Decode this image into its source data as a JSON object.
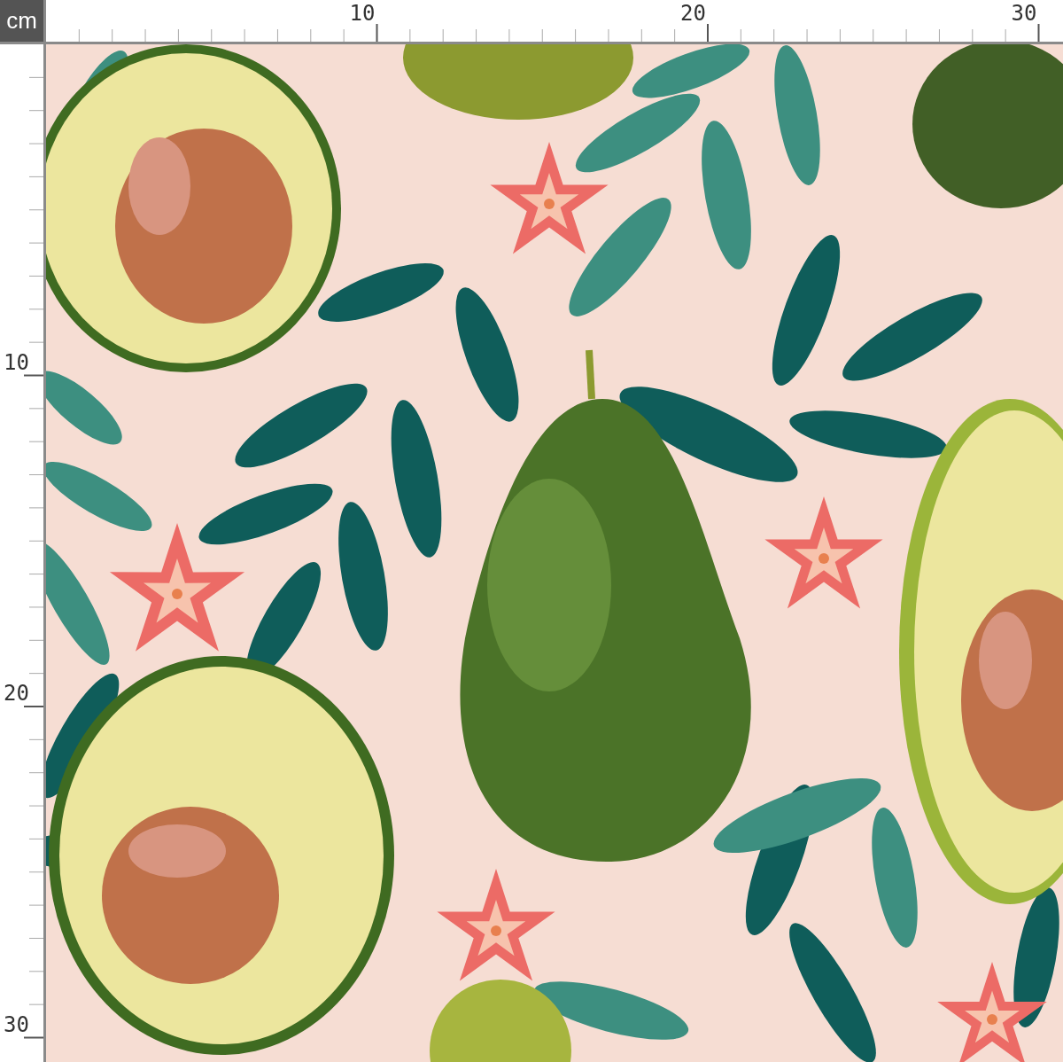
{
  "unit_label": "cm",
  "top_ruler": {
    "labels": [
      "10",
      "20",
      "30"
    ]
  },
  "left_ruler": {
    "labels": [
      "10",
      "20",
      "30"
    ]
  }
}
